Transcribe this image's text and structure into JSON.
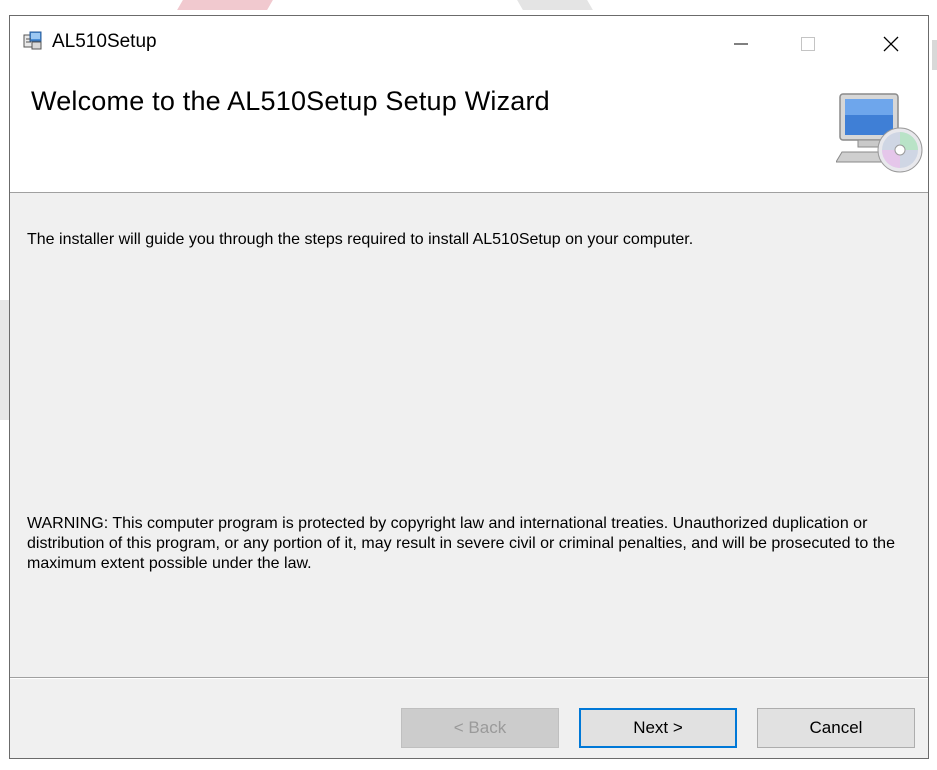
{
  "window": {
    "title": "AL510Setup",
    "buttons": {
      "minimize": "—",
      "maximize": "□",
      "close": "✕"
    }
  },
  "header": {
    "title": "Welcome to the AL510Setup Setup Wizard",
    "icon": "computer-with-disc-icon"
  },
  "body": {
    "intro": "The installer will guide you through the steps required to install AL510Setup on your computer.",
    "warning": "WARNING: This computer program is protected by copyright law and international treaties. Unauthorized duplication or distribution of this program, or any portion of it, may result in severe civil or criminal penalties, and will be prosecuted to the maximum extent possible under the law."
  },
  "footer": {
    "back_label": "< Back",
    "next_label": "Next >",
    "cancel_label": "Cancel"
  },
  "colors": {
    "dialog_bg": "#f0f0f0",
    "focus_border": "#0078d7",
    "disabled_text": "#9a9a9a"
  }
}
